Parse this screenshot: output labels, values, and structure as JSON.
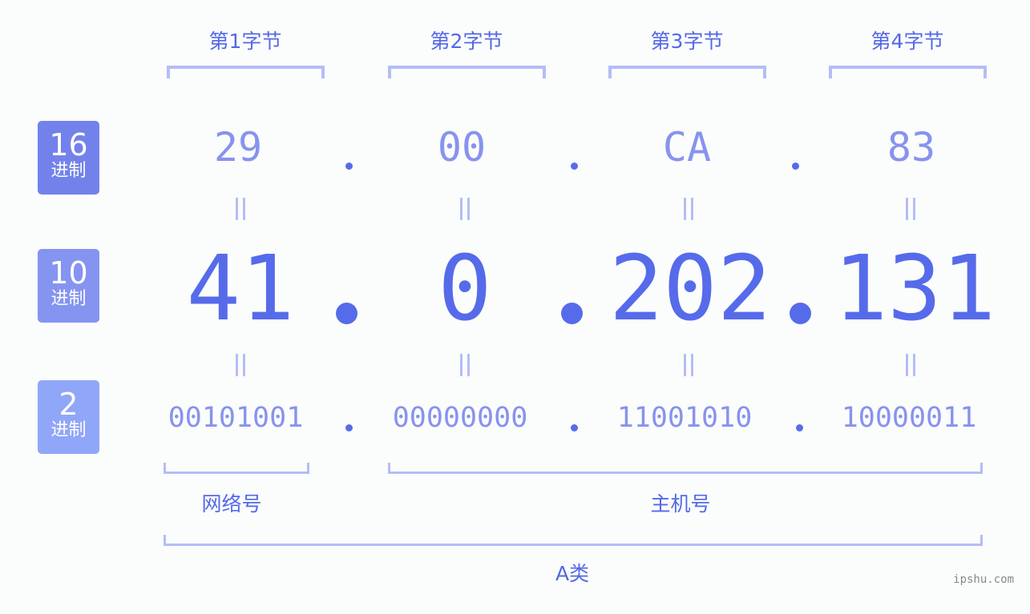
{
  "byte_headers": [
    "第1字节",
    "第2字节",
    "第3字节",
    "第4字节"
  ],
  "rows": {
    "hex": {
      "badge_num": "16",
      "badge_sub": "进制",
      "badge_color": "#7282ea",
      "values": [
        "29",
        "00",
        "CA",
        "83"
      ]
    },
    "dec": {
      "badge_num": "10",
      "badge_sub": "进制",
      "badge_color": "#8594f0",
      "values": [
        "41",
        "0",
        "202",
        "131"
      ]
    },
    "bin": {
      "badge_num": "2",
      "badge_sub": "进制",
      "badge_color": "#90a6f8",
      "values": [
        "00101001",
        "00000000",
        "11001010",
        "10000011"
      ]
    }
  },
  "separator": ".",
  "segments": {
    "network": "网络号",
    "host": "主机号",
    "class": "A类"
  },
  "watermark": "ipshu.com",
  "colors": {
    "accent": "#566bea",
    "light": "#8793ee",
    "bracket": "#b4bdf7"
  }
}
